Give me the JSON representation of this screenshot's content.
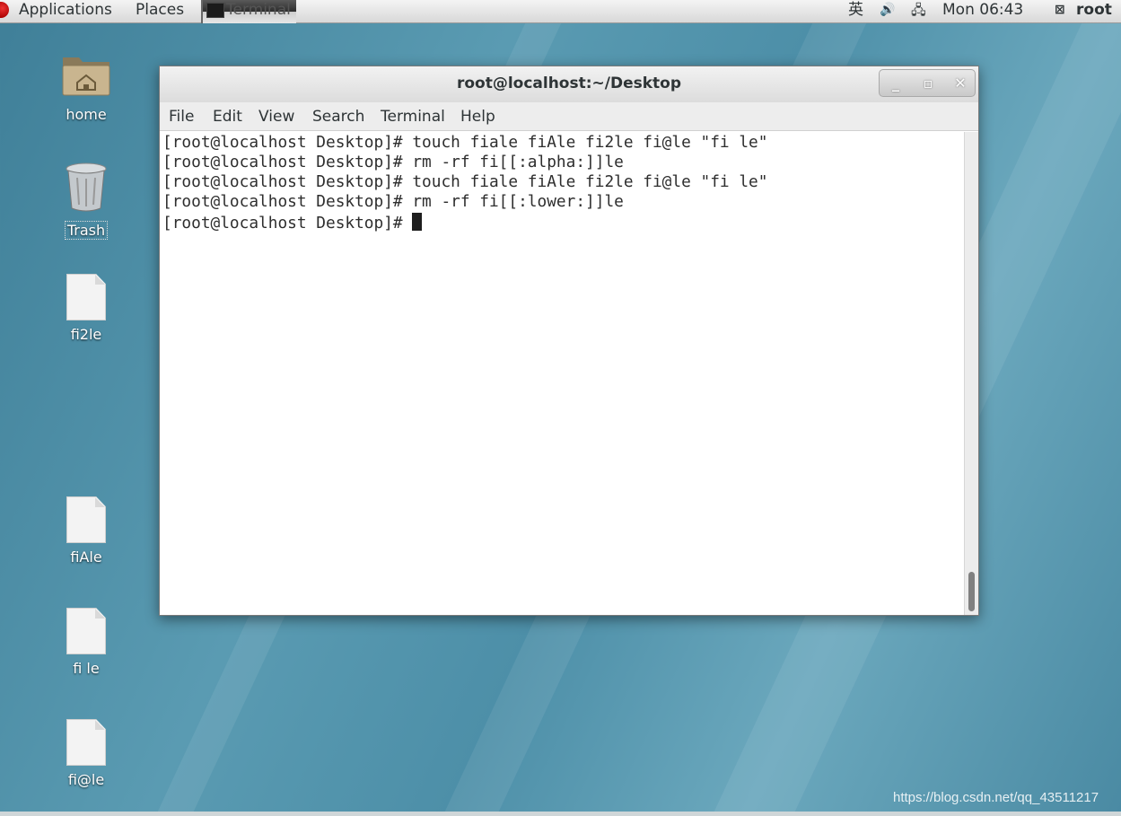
{
  "top_panel": {
    "applications_label": "Applications",
    "places_label": "Places",
    "taskbar_terminal_label": "Terminal",
    "ime_label": "英",
    "volume_icon": "volume-icon",
    "network_icon": "network-icon",
    "clock": "Mon 06:43",
    "user_name": "root"
  },
  "desktop_icons": [
    {
      "label": "home",
      "icon": "home-folder-icon"
    },
    {
      "label": "Trash",
      "icon": "trash-icon"
    },
    {
      "label": "fi2le",
      "icon": "file-icon"
    },
    {
      "label": "fiAle",
      "icon": "file-icon"
    },
    {
      "label": "fi le",
      "icon": "file-icon"
    },
    {
      "label": "fi@le",
      "icon": "file-icon"
    }
  ],
  "terminal": {
    "title": "root@localhost:~/Desktop",
    "menu": [
      "File",
      "Edit",
      "View",
      "Search",
      "Terminal",
      "Help"
    ],
    "lines": [
      "[root@localhost Desktop]# touch fiale fiAle fi2le fi@le \"fi le\"",
      "[root@localhost Desktop]# rm -rf fi[[:alpha:]]le",
      "[root@localhost Desktop]# touch fiale fiAle fi2le fi@le \"fi le\"",
      "[root@localhost Desktop]# rm -rf fi[[:lower:]]le",
      "[root@localhost Desktop]# "
    ]
  },
  "watermark": "https://blog.csdn.net/qq_43511217"
}
